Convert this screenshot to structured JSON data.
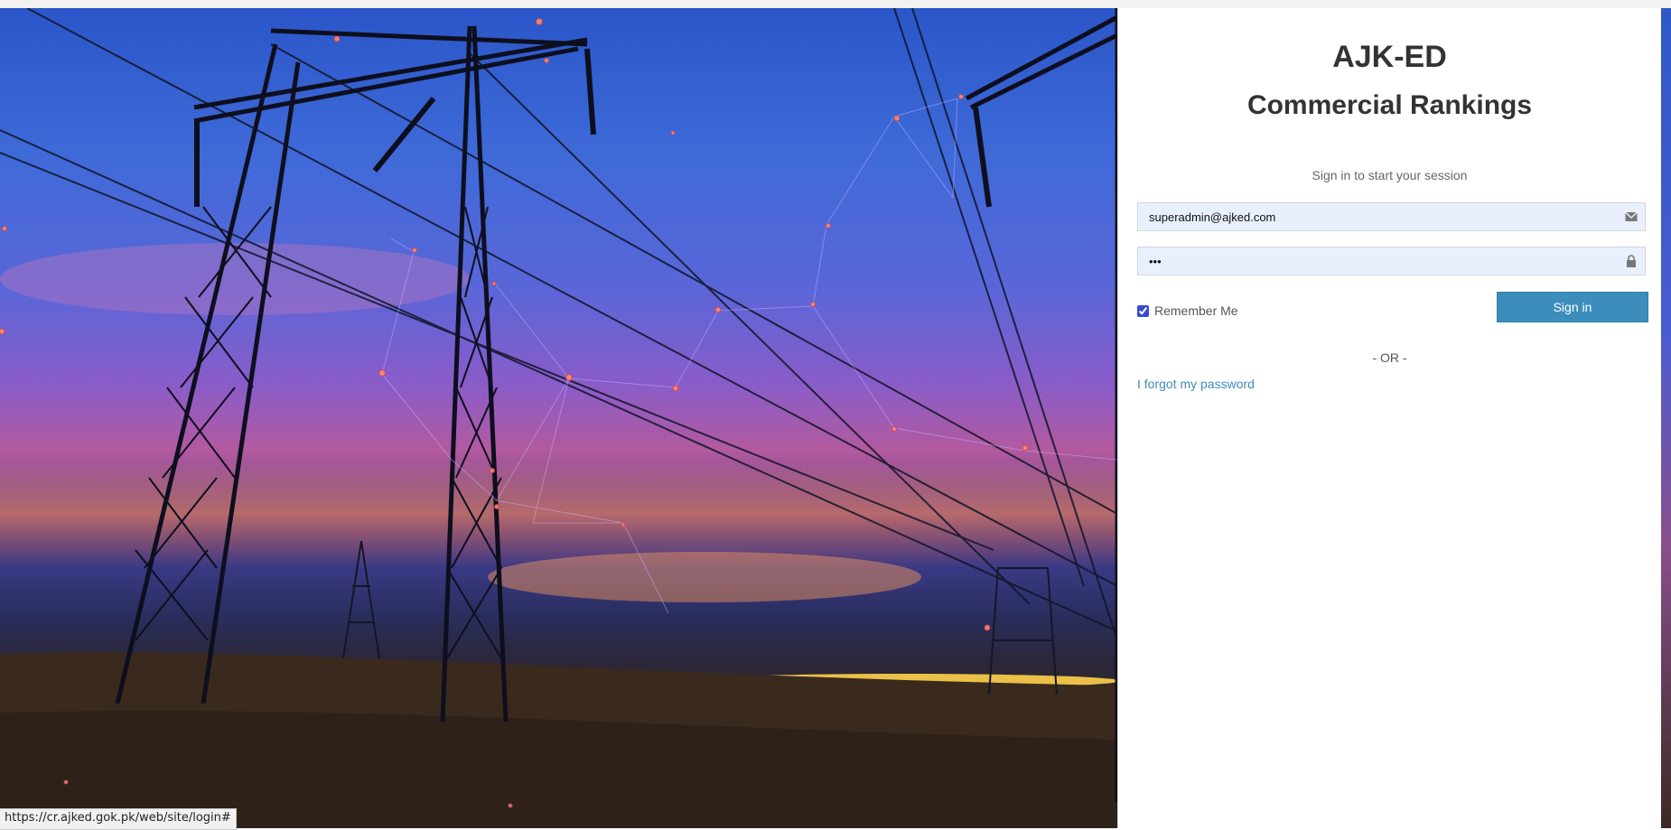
{
  "app": {
    "title": "AJK-ED",
    "subtitle": "Commercial Rankings"
  },
  "login": {
    "message": "Sign in to start your session",
    "email_value": "superadmin@ajked.com",
    "password_value": "•••",
    "remember_label": "Remember Me",
    "remember_checked": true,
    "signin_label": "Sign in",
    "or_label": "- OR -",
    "forgot_label": "I forgot my password"
  },
  "icons": {
    "email": "envelope-icon",
    "password": "lock-icon"
  },
  "colors": {
    "primary_button": "#3c8dbc",
    "link": "#3c8dbc",
    "input_bg": "#e8f0fe",
    "heading": "#333333"
  },
  "statusbar": {
    "url": "https://cr.ajked.gok.pk/web/site/login#"
  }
}
